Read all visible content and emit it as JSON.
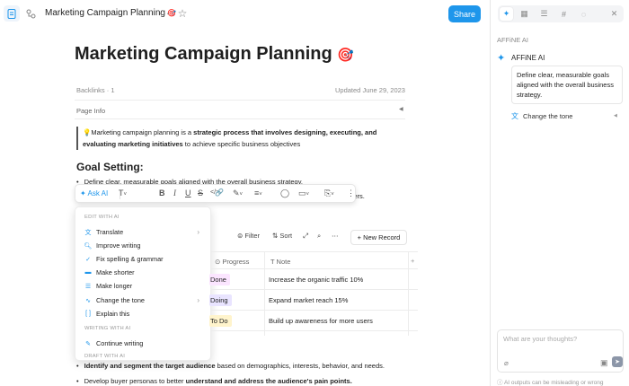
{
  "topbar": {
    "doc_title": "Marketing Campaign Planning",
    "share_label": "Share",
    "more_icon": "more-icon",
    "star_icon": "star-icon"
  },
  "doc": {
    "title": "Marketing Campaign Planning",
    "title_emoji": "🎯",
    "backlinks": "Backlinks · 1",
    "updated": "Updated June 29, 2023",
    "page_info": "Page Info",
    "quote_parts": {
      "pre": "💡Marketing campaign planning is a ",
      "bold": "strategic process that involves designing, executing, and evaluating marketing initiatives",
      "post": " to achieve specific business objectives"
    },
    "goal_heading": "Goal Setting:",
    "bullet1": "Define clear, measurable goals aligned with the overall business strategy.",
    "bullet2_tail": "ribers.",
    "bullet3_bold": "Identify and segment the target audience",
    "bullet3_rest": " based on demographics, interests, behavior, and needs.",
    "bullet4_pre": "Develop buyer personas to better ",
    "bullet4_bold": "understand and address the audience's pain points."
  },
  "toolbar": {
    "ask_ai": "Ask AI"
  },
  "menu": {
    "section_edit": "EDIT WITH AI",
    "section_write": "WRITING WITH AI",
    "section_draft": "DRAFT WITH AI",
    "items": [
      {
        "label": "Translate",
        "icon": "translate-icon"
      },
      {
        "label": "Improve writing",
        "icon": "search-icon"
      },
      {
        "label": "Fix spelling & grammar",
        "icon": "check-icon"
      },
      {
        "label": "Make shorter",
        "icon": "shorter-icon"
      },
      {
        "label": "Make longer",
        "icon": "longer-icon"
      },
      {
        "label": "Change the tone",
        "icon": "wave-icon"
      },
      {
        "label": "Explain this",
        "icon": "brackets-icon"
      }
    ],
    "continue_writing": "Continue writing"
  },
  "table": {
    "filter": "Filter",
    "sort": "Sort",
    "new_record": "+ New Record",
    "headers": [
      "Progress",
      "Note"
    ],
    "rows": [
      {
        "progress": "Done",
        "note": "Increase the organic traffic 10%",
        "color": "#fbe5ff"
      },
      {
        "progress": "Doing",
        "note": "Expand market reach 15%",
        "color": "#e9e4ff"
      },
      {
        "progress": "To Do",
        "note": "Build up awareness for more users",
        "color": "#fff4cc"
      }
    ]
  },
  "panel": {
    "header": "AFFiNE AI",
    "ai_name": "AFFiNE AI",
    "message": "Define clear, measurable goals aligned with the overall business strategy.",
    "action": "Change the tone",
    "placeholder": "What are your thoughts?",
    "footer": "AI outputs can be misleading or wrong"
  },
  "colors": {
    "accent": "#1e96eb"
  }
}
